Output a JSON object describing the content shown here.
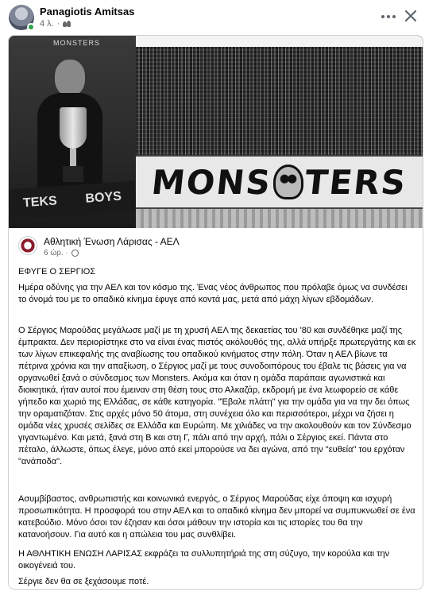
{
  "header": {
    "author": "Panagiotis Amitsas",
    "time": "4 λ.",
    "privacy_icon": "friends-icon",
    "more_icon": "more-horizontal-icon",
    "close_icon": "close-icon"
  },
  "photo": {
    "sign_text": "MONSTERS",
    "banner_left": "MONS",
    "banner_right": "TERS",
    "scarf_left": "TEKS",
    "scarf_right": "BOYS"
  },
  "shared_post": {
    "page_name": "Αθλητική Ένωση Λάρισας - ΑΕΛ",
    "time": "6 ώρ. ·",
    "privacy_icon": "globe-icon",
    "paragraphs": [
      "ΕΦΥΓΕ Ο ΣΕΡΓΙΟΣ",
      "Ημέρα οδύνης για την ΑΕΛ και τον κόσμο της. Ένας νέος άνθρωπος που πρόλαβε όμως να συνδέσει το όνομά του με το οπαδικό κίνημα έφυγε από κοντά μας, μετά από μάχη λίγων εβδομάδων.",
      "Ο Σέργιος Μαρούδας μεγάλωσε μαζί με τη χρυσή ΑΕΛ της δεκαετίας του '80 και συνδέθηκε μαζί της έμπρακτα. Δεν περιορίστηκε στο να είναι ένας πιστός ακόλουθός της, αλλά υπήρξε πρωτεργάτης και εκ των λίγων επικεφαλής της αναβίωσης του οπαδικού κινήματος στην πόλη. Όταν η ΑΕΛ βίωνε τα πέτρινα χρόνια και την απαξίωση, ο Σέργιος μαζί με τους συνοδοιπόρους του έβαλε τις βάσεις για να οργανωθεί ξανά ο σύνδεσμος των Monsters. Ακόμα και όταν η ομάδα παράπαιε αγωνιστικά και διοικητικά, ήταν αυτοί που έμειναν στη θέση τους στο Αλκαζάρ, εκδρομή με ένα λεωφορείο σε κάθε γήπεδο και χωριό της Ελλάδας, σε κάθε κατηγορία. \"Έβαλε πλάτη\" για την ομάδα για να την δει όπως την οραματιζόταν. Στις αρχές μόνο 50 άτομα, στη συνέχεια όλο και περισσότεροι, μέχρι να ζήσει η ομάδα νέες χρυσές σελίδες σε Ελλάδα και Ευρώπη. Με χιλιάδες να την ακολουθούν και τον Σύνδεσμο γιγαντωμένο. Και μετά, ξανά στη Β και στη Γ, πάλι από την αρχή, πάλι ο Σέργιος εκεί. Πάντα στο πέταλο, άλλωστε, όπως έλεγε, μόνο από εκεί μπορούσε να δει αγώνα, από την \"ευθεία\" του ερχόταν \"ανάποδα\".",
      "Ασυμβίβαστος, ανθρωπιστής και κοινωνικά ενεργός, ο Σέργιος Μαρούδας είχε άποψη και ισχυρή προσωπικότητα. Η προσφορά του στην ΑΕΛ και το οπαδικό κίνημα δεν μπορεί να συμπυκνωθεί σε ένα κατεβούδιο. Μόνο όσοι τον έζησαν και όσοι μάθουν την ιστορία και τις ιστορίες του θα την κατανοήσουν. Για αυτό και η απώλεια του μας συνθλίβει.",
      "Η ΑΘΛΗΤΙΚΗ ΕΝΩΣΗ ΛΑΡΙΣΑΣ εκφράζει τα συλλυπητήριά της στη σύζυγο, την κορούλα και την οικογένειά του.",
      "Σέργιε δεν θα σε ξεχάσουμε ποτέ."
    ]
  }
}
